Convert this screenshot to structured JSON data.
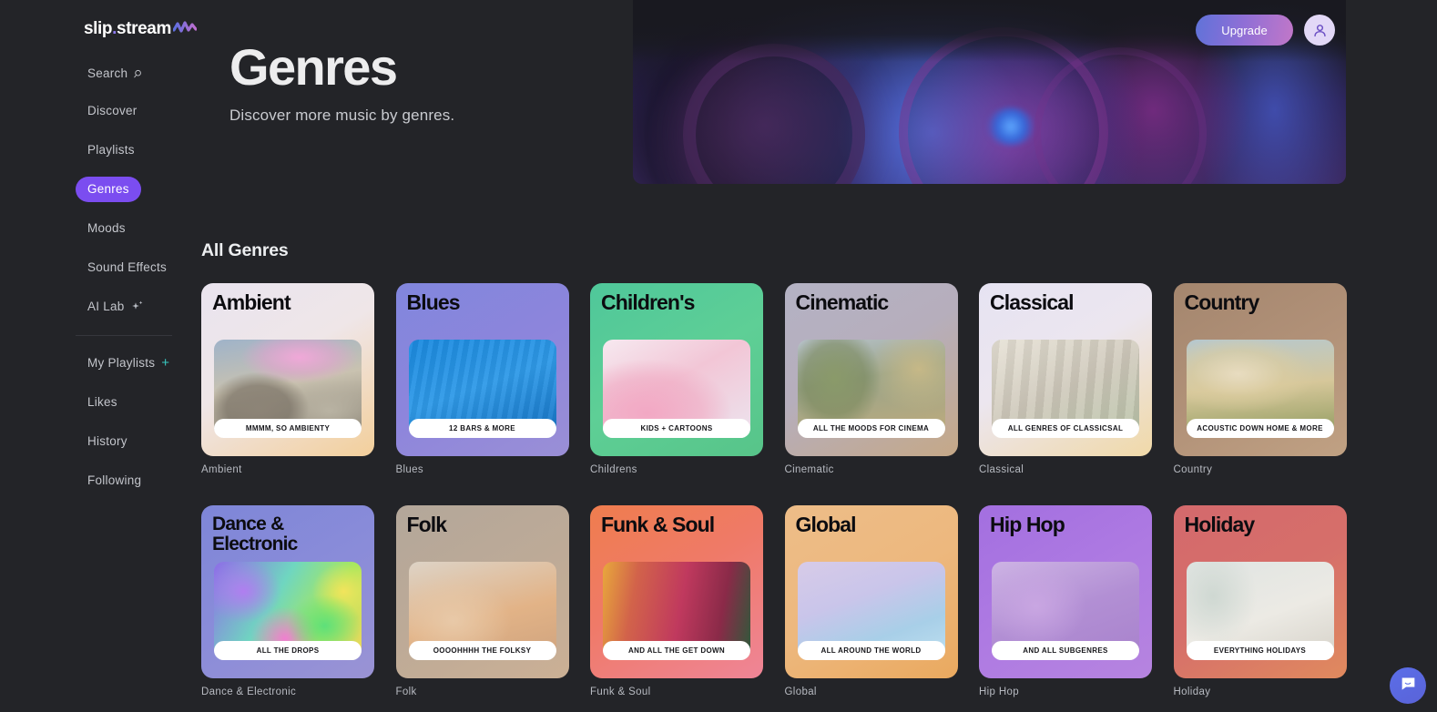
{
  "brand": {
    "name_a": "slip",
    "dot": ".",
    "name_b": "stream"
  },
  "topbar": {
    "upgrade_label": "Upgrade",
    "avatar_name": "user-avatar"
  },
  "sidebar": {
    "primary": [
      {
        "label": "Search",
        "icon": "search-icon",
        "active": false
      },
      {
        "label": "Discover",
        "icon": null,
        "active": false
      },
      {
        "label": "Playlists",
        "icon": null,
        "active": false
      },
      {
        "label": "Genres",
        "icon": null,
        "active": true
      },
      {
        "label": "Moods",
        "icon": null,
        "active": false
      },
      {
        "label": "Sound Effects",
        "icon": null,
        "active": false
      },
      {
        "label": "AI Lab",
        "icon": "sparkle-icon",
        "active": false
      }
    ],
    "secondary": [
      {
        "label": "My Playlists",
        "icon": "plus-icon"
      },
      {
        "label": "Likes",
        "icon": null
      },
      {
        "label": "History",
        "icon": null
      },
      {
        "label": "Following",
        "icon": null
      }
    ]
  },
  "hero": {
    "title": "Genres",
    "subtitle": "Discover more music by genres."
  },
  "section": {
    "title": "All Genres"
  },
  "colors": {
    "page_bg": "#232428",
    "accent_purple": "#7b4df0",
    "plus_teal": "#38c7c0",
    "upgrade_gradient_start": "#5f72d9",
    "upgrade_gradient_end": "#c277c8"
  },
  "genres": [
    {
      "title": "Ambient",
      "tagline": "MMMM, SO AMBIENTY",
      "label": "Ambient",
      "card_bg": "linear-gradient(150deg,#e9e4ef 0%,#efe6e8 45%,#f3cf9b 100%)",
      "photo_class": "ph-ambient"
    },
    {
      "title": "Blues",
      "tagline": "12 BARS & MORE",
      "label": "Blues",
      "card_bg": "linear-gradient(150deg,#8186dd 0%,#8d85dc 50%,#9a8fd6 100%)",
      "photo_class": "ph-blues"
    },
    {
      "title": "Children's",
      "tagline": "KIDS + CARTOONS",
      "label": "Childrens",
      "card_bg": "linear-gradient(150deg,#4fc79a 0%,#5ecf96 50%,#57c489 100%)",
      "photo_class": "ph-children"
    },
    {
      "title": "Cinematic",
      "tagline": "ALL THE MOODS FOR CINEMA",
      "label": "Cinematic",
      "card_bg": "linear-gradient(150deg,#b4b2c4 0%,#b6aebc 45%,#c5a887 100%)",
      "photo_class": "ph-cinematic"
    },
    {
      "title": "Classical",
      "tagline": "ALL GENRES OF CLASSICSAL",
      "label": "Classical",
      "card_bg": "linear-gradient(150deg,#e6e3f2 0%,#ece6ef 45%,#f0d9a8 100%)",
      "photo_class": "ph-classical"
    },
    {
      "title": "Country",
      "tagline": "ACOUSTIC DOWN HOME & MORE",
      "label": "Country",
      "card_bg": "linear-gradient(150deg,#a4866e 0%,#b19178 50%,#c0a183 100%)",
      "photo_class": "ph-country"
    },
    {
      "title": "Dance & Electronic",
      "tagline": "ALL THE DROPS",
      "label": "Dance & Electronic",
      "card_bg": "linear-gradient(150deg,#7e86d8 0%,#8a8cd9 50%,#9a93d4 100%)",
      "photo_class": "ph-dance"
    },
    {
      "title": "Folk",
      "tagline": "OOOOHHHH THE FOLKSY",
      "label": "Folk",
      "card_bg": "linear-gradient(150deg,#b3a79a 0%,#bdaa97 50%,#cbb095 100%)",
      "photo_class": "ph-folk"
    },
    {
      "title": "Funk & Soul",
      "tagline": "AND ALL THE GET DOWN",
      "label": "Funk & Soul",
      "card_bg": "linear-gradient(150deg,#ef7d4e 0%,#ef7a68 45%,#ef8597 100%)",
      "photo_class": "ph-funk"
    },
    {
      "title": "Global",
      "tagline": "ALL AROUND THE WORLD",
      "label": "Global",
      "card_bg": "linear-gradient(150deg,#edbd88 0%,#edb87e 50%,#eaa95f 100%)",
      "photo_class": "ph-global"
    },
    {
      "title": "Hip Hop",
      "tagline": "AND ALL SUBGENRES",
      "label": "Hip Hop",
      "card_bg": "linear-gradient(150deg,#a36fe0 0%,#ae7ae2 50%,#b684e0 100%)",
      "photo_class": "ph-hiphop"
    },
    {
      "title": "Holiday",
      "tagline": "EVERYTHING HOLIDAYS",
      "label": "Holiday",
      "card_bg": "linear-gradient(150deg,#d4696c 0%,#d66f6a 50%,#e08a5e 100%)",
      "photo_class": "ph-holiday"
    }
  ],
  "chat_widget": {
    "name": "chat-bubble-icon"
  }
}
